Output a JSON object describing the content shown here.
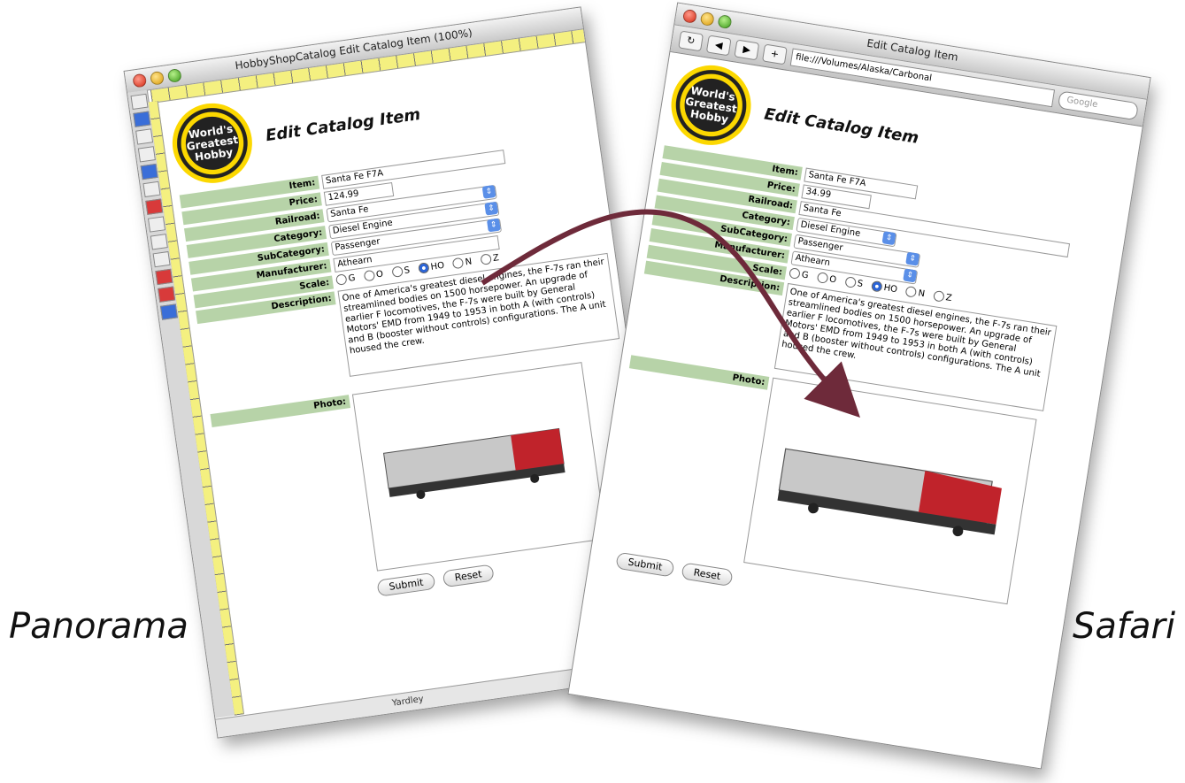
{
  "labels": {
    "left": "Panorama",
    "right": "Safari"
  },
  "panorama": {
    "title": "HobbyShopCatalog Edit Catalog Item (100%)",
    "status_text": "Yardley",
    "form": {
      "badge_text": "World's Greatest Hobby",
      "heading": "Edit Catalog Item",
      "item_label": "Item:",
      "item_value": "Santa Fe F7A",
      "price_label": "Price:",
      "price_value": "124.99",
      "railroad_label": "Railroad:",
      "railroad_value": "Santa Fe",
      "category_label": "Category:",
      "category_value": "Diesel Engine",
      "subcategory_label": "SubCategory:",
      "subcategory_value": "Passenger",
      "manufacturer_label": "Manufacturer:",
      "manufacturer_value": "Athearn",
      "scale_label": "Scale:",
      "scales": [
        "G",
        "O",
        "S",
        "HO",
        "N",
        "Z"
      ],
      "scale_selected": "HO",
      "description_label": "Description:",
      "description": "One of America's greatest diesel engines, the F-7s ran their streamlined bodies on 1500 horsepower. An upgrade of earlier F locomotives, the F-7s were built by General Motors' EMD from 1949 to 1953 in both A (with controls) and B (booster without controls) configurations. The A unit housed the crew.",
      "photo_label": "Photo:",
      "submit": "Submit",
      "reset": "Reset"
    }
  },
  "safari": {
    "title": "Edit Catalog Item",
    "address": "file:///Volumes/Alaska/Carbonal",
    "search_placeholder": "Google",
    "form": {
      "badge_text": "World's Greatest Hobby",
      "heading": "Edit Catalog Item",
      "item_label": "Item:",
      "item_value": "Santa Fe F7A",
      "price_label": "Price:",
      "price_value": "34.99",
      "railroad_label": "Railroad:",
      "railroad_value": "Santa Fe",
      "category_label": "Category:",
      "category_value": "Diesel Engine",
      "subcategory_label": "SubCategory:",
      "subcategory_value": "Passenger",
      "manufacturer_label": "Manufacturer:",
      "manufacturer_value": "Athearn",
      "scale_label": "Scale:",
      "scales": [
        "G",
        "O",
        "S",
        "HO",
        "N",
        "Z"
      ],
      "scale_selected": "HO",
      "description_label": "Description:",
      "description": "One of America's greatest diesel engines, the F-7s ran their streamlined bodies on 1500 horsepower. An upgrade of earlier F locomotives, the F-7s were built by General Motors' EMD from 1949 to 1953 in both A (with controls) and B (booster without controls) configurations. The A unit housed the crew.",
      "photo_label": "Photo:",
      "submit": "Submit",
      "reset": "Reset"
    }
  },
  "colors": {
    "label_bg": "#b7d3a8",
    "arrow": "#6e2a3a",
    "ruler": "#f4f080"
  }
}
